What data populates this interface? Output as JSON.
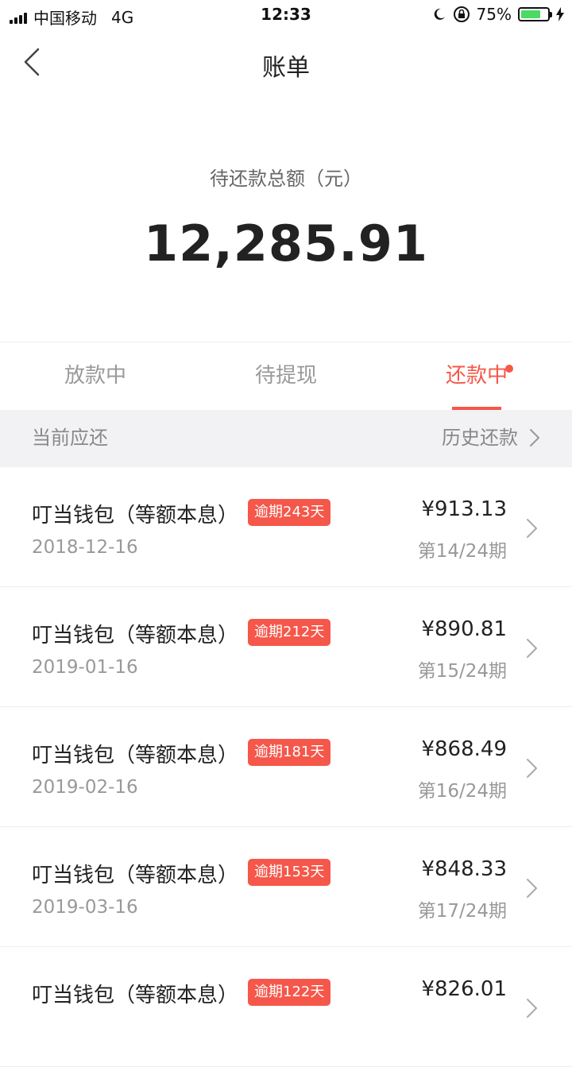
{
  "status_bar": {
    "carrier": "中国移动",
    "network": "4G",
    "time": "12:33",
    "battery_percent": "75%",
    "battery_level": 0.75
  },
  "nav": {
    "back_icon": "chevron-left-icon",
    "title": "账单"
  },
  "summary": {
    "label": "待还款总额（元）",
    "amount": "12,285.91"
  },
  "tabs": [
    {
      "label": "放款中",
      "active": false
    },
    {
      "label": "待提现",
      "active": false
    },
    {
      "label": "还款中",
      "active": true,
      "has_dot": true
    }
  ],
  "section": {
    "left_label": "当前应还",
    "right_label": "历史还款"
  },
  "bills": [
    {
      "name": "叮当钱包（等额本息）",
      "badge": "逾期243天",
      "date": "2018-12-16",
      "amount": "¥913.13",
      "period": "第14/24期"
    },
    {
      "name": "叮当钱包（等额本息）",
      "badge": "逾期212天",
      "date": "2019-01-16",
      "amount": "¥890.81",
      "period": "第15/24期"
    },
    {
      "name": "叮当钱包（等额本息）",
      "badge": "逾期181天",
      "date": "2019-02-16",
      "amount": "¥868.49",
      "period": "第16/24期"
    },
    {
      "name": "叮当钱包（等额本息）",
      "badge": "逾期153天",
      "date": "2019-03-16",
      "amount": "¥848.33",
      "period": "第17/24期"
    },
    {
      "name": "叮当钱包（等额本息）",
      "badge": "逾期122天",
      "date": "",
      "amount": "¥826.01",
      "period": ""
    }
  ],
  "colors": {
    "accent": "#f5574a",
    "section_bg": "#f2f2f4"
  }
}
